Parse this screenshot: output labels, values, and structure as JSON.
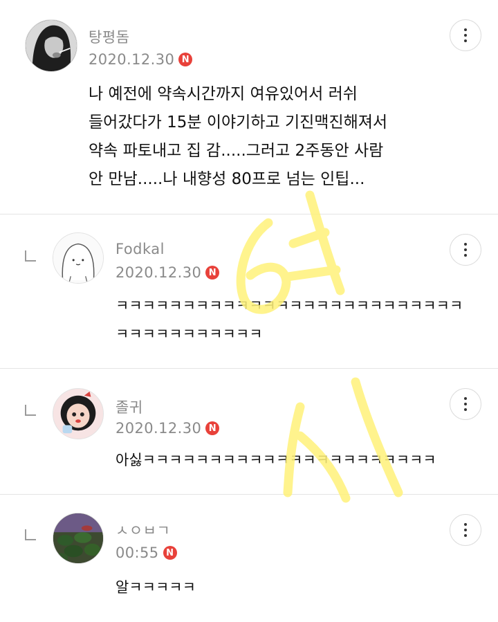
{
  "comments": [
    {
      "author": "탕평돔",
      "date": "2020.12.30",
      "badge": "N",
      "lines": [
        "나 예전에 약속시간까지 여유있어서 러쉬",
        "들어갔다가 15분 이야기하고 기진맥진해져서",
        "약속 파토내고 집 감.....그러고 2주동안 사람",
        "안 만남.....나 내향성 80프로 넘는 인팁..."
      ]
    },
    {
      "author": "Fodkal",
      "date": "2020.12.30",
      "badge": "N",
      "lines": [
        "ㅋㅋㅋㅋㅋㅋㅋㅋㅋㅋㅋㅋㅋㅋㅋㅋㅋㅋㅋㅋㅋㅋㅋㅋㅋㅋ",
        "ㅋㅋㅋㅋㅋㅋㅋㅋㅋㅋㅋ"
      ]
    },
    {
      "author": "졸귀",
      "date": "2020.12.30",
      "badge": "N",
      "lines": [
        "아싫ㅋㅋㅋㅋㅋㅋㅋㅋㅋㅋㅋㅋㅋㅋㅋㅋㅋㅋㅋㅋㅋㅋ"
      ]
    },
    {
      "author": "ㅅㅇㅂㄱ",
      "date": "00:55",
      "badge": "N",
      "lines": [
        "알ㅋㅋㅋㅋㅋ"
      ]
    }
  ],
  "colors": {
    "badge": "#e8413a",
    "watermark": "#fff27a"
  },
  "icons": {
    "more": "more-vertical-icon",
    "reply": "reply-arrow-icon"
  }
}
